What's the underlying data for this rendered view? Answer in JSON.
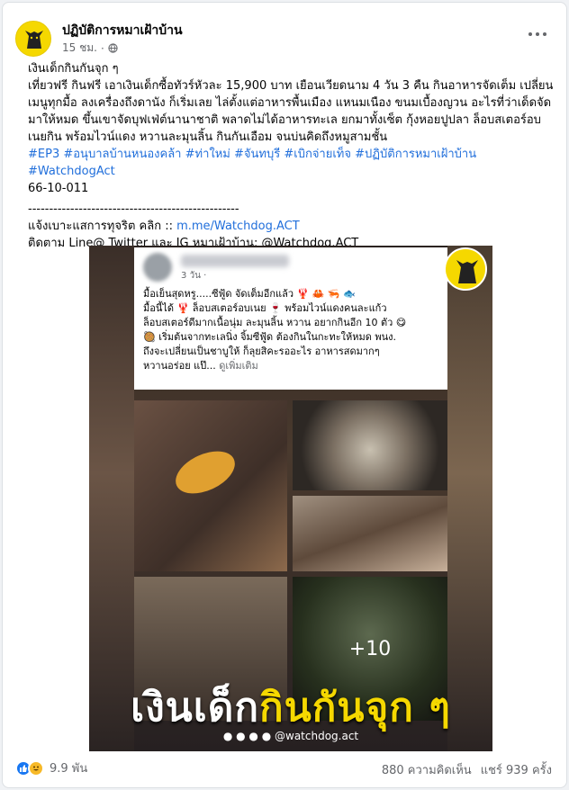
{
  "page": {
    "name": "ปฏิบัติการหมาเฝ้าบ้าน",
    "time": "15 ชม.",
    "more_icon": "ellipsis-icon",
    "privacy_icon": "globe-icon"
  },
  "post": {
    "title": "เงินเด็กกินกันจุก ๆ",
    "body": "เที่ยวฟรี กินฟรี เอาเงินเด็กซื้อทัวร์หัวละ 15,900 บาท เยือนเวียดนาม 4 วัน 3 คืน กินอาหารจัดเต็ม เปลี่ยนเมนูทุกมื้อ ลงเครื่องถึงดานัง ก็เริ่มเลย ไล่ตั้งแต่อาหารพื้นเมือง แหนมเนือง ขนมเบื้องญวน อะไรที่ว่าเด็ดจัดมาให้หมด ขึ้นเขาจัดบุฟเฟ่ต์นานาชาติ พลาดไม่ได้อาหารทะเล ยกมาทั้งเซ็ต กุ้งหอยปูปลา ล็อบสเตอร์อบเนยกิน พร้อมไวน์แดง หวานละมุนลิ้น กินกันเอือม จนบ่นคิดถึงหมูสามชั้น",
    "hashtags": [
      "#EP3",
      "#อนุบาลบ้านหนองคล้า",
      "#ท่าใหม่",
      "#จันทบุรี",
      "#เบิกจ่ายเท็จ",
      "#ปฏิบัติการหมาเฝ้าบ้าน",
      "#WatchdogAct"
    ],
    "code": "66-10-011",
    "separator": "--------------------------------------------------",
    "report_label": "แจ้งเบาะแสการทุจริต คลิก :: ",
    "report_link": "m.me/Watchdog.ACT",
    "follow": "ติดตาม Line@ Twitter และ IG หมาเฝ้าบ้าน: @Watchdog.ACT"
  },
  "image": {
    "inner_time": "3 วัน ·",
    "inner_body": [
      "มื้อเย็นสุดหรู.....ซีฟู้ด จัดเต็มอีกแล้ว 🦞 🦀 🦐 🐟",
      "มื้อนี้ได้ 🦞 ล็อบสเตอร์อบเนย 🍷 พร้อมไวน์แดงคนละแก้ว",
      "ล็อบสเตอร์ดีมากเนื้อนุ่ม ละมุนลิ้น หวาน อยากกินอีก 10 ตัว 😋",
      "🥘 เริ่มต้นจากทะเลนิ่ง จิ้มซีฟู้ด ต้องกินในกะทะให้หมด พนง.",
      "ถึงจะเปลี่ยนเป็นชาบูให้ ก็ลุยสิคะรออะไร อาหารสดมากๆ",
      "หวานอร่อย แป๊..."
    ],
    "see_more": "ดูเพิ่มเติม",
    "plus_count": "+10",
    "overlay_white": "เงินเด็ก",
    "overlay_yellow": "กินกันจุก ๆ",
    "social_handle": "@watchdog.act"
  },
  "footer": {
    "reaction_count": "9.9 พัน",
    "comments": "880 ความคิดเห็น",
    "shares": "แชร์ 939 ครั้ง"
  },
  "colors": {
    "link": "#216fdb",
    "accent_yellow": "#f5d800",
    "like_blue": "#1877f2"
  }
}
